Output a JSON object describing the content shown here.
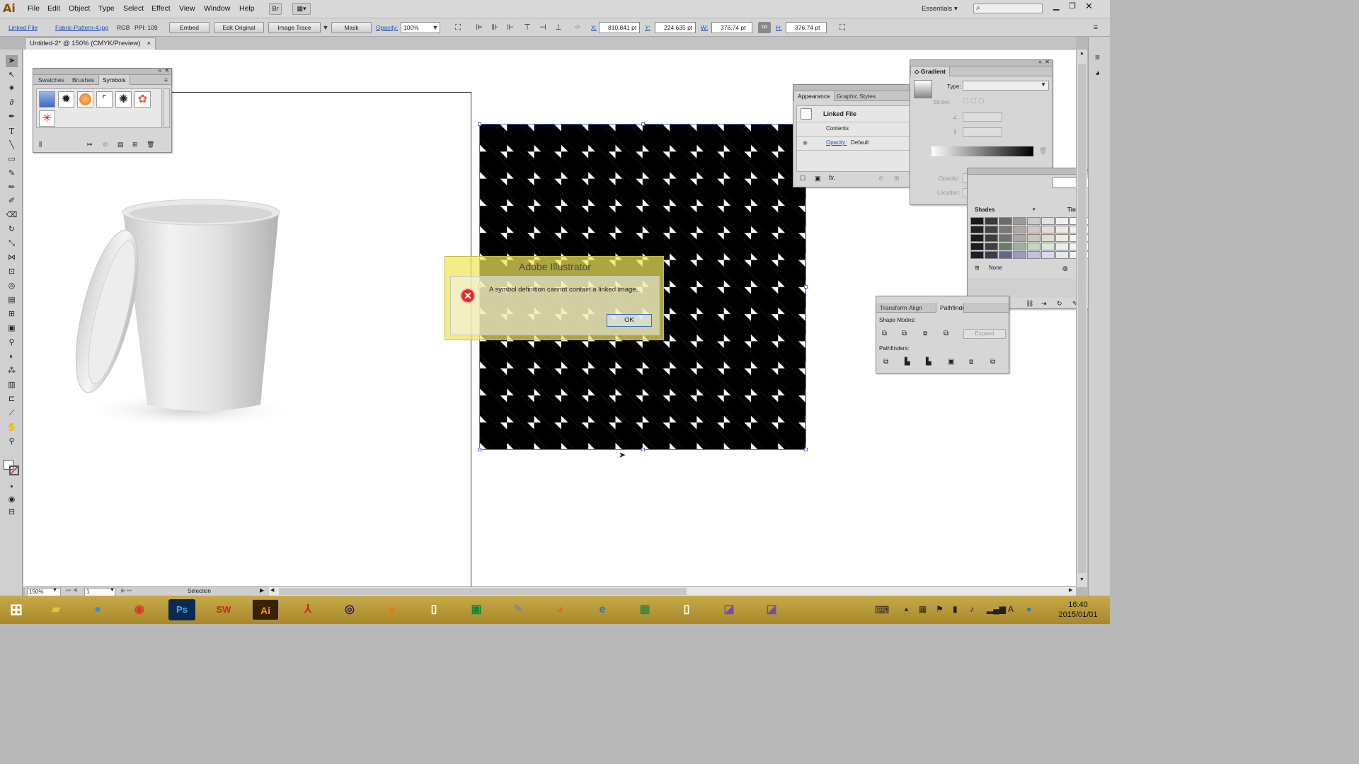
{
  "app": {
    "logo": "Ai",
    "workspace": "Essentials",
    "search_placeholder": ""
  },
  "menu": [
    "File",
    "Edit",
    "Object",
    "Type",
    "Select",
    "Effect",
    "View",
    "Window",
    "Help"
  ],
  "control": {
    "linked_file": "Linked File",
    "filename": "Fabric-Pattern-4.jpg",
    "color_mode": "RGB",
    "ppi": "PPI: 109",
    "embed": "Embed",
    "edit_original": "Edit Original",
    "image_trace": "Image Trace",
    "mask": "Mask",
    "opacity_label": "Opacity:",
    "opacity_value": "100%",
    "x_label": "X:",
    "x_value": "810.841 pt",
    "y_label": "Y:",
    "y_value": "224.635 pt",
    "w_label": "W:",
    "w_value": "376.74 pt",
    "h_label": "H:",
    "h_value": "376.74 pt"
  },
  "document": {
    "tab_title": "Untitled-2* @ 150% (CMYK/Preview)",
    "close": "×"
  },
  "symbols_panel": {
    "tabs": [
      "Swatches",
      "Brushes",
      "Symbols"
    ],
    "active_tab": "Symbols"
  },
  "appearance_panel": {
    "tabs": [
      "Appearance",
      "Graphic Styles"
    ],
    "item_title": "Linked File",
    "contents": "Contents",
    "opacity_label": "Opacity:",
    "opacity_value": "Default",
    "fx": "fx."
  },
  "gradient_panel": {
    "title": "Gradient",
    "type_label": "Type:",
    "stroke_label": "Stroke:",
    "opacity_label": "Opacity:",
    "location_label": "Location:"
  },
  "color_guide": {
    "shades": "Shades",
    "tints": "Tints",
    "none": "None"
  },
  "transform_panel": {
    "tabs": [
      "Transform",
      "Align",
      "Pathfinder"
    ],
    "shape_modes": "Shape Modes:",
    "pathfinders": "Pathfinders:",
    "expand": "Expand"
  },
  "dialog": {
    "title": "Adobe Illustrator",
    "message": "A symbol definition cannot contain a linked image.",
    "ok": "OK"
  },
  "status": {
    "zoom": "150%",
    "page": "1",
    "tool": "Selection"
  },
  "taskbar": {
    "time": "16:40",
    "date": "2015/01/01"
  },
  "colors": {
    "accent": "#1a4fbf",
    "dialog_yellow": "#eee65a",
    "error_red": "#d9302a",
    "taskbar": "#b89a36"
  }
}
